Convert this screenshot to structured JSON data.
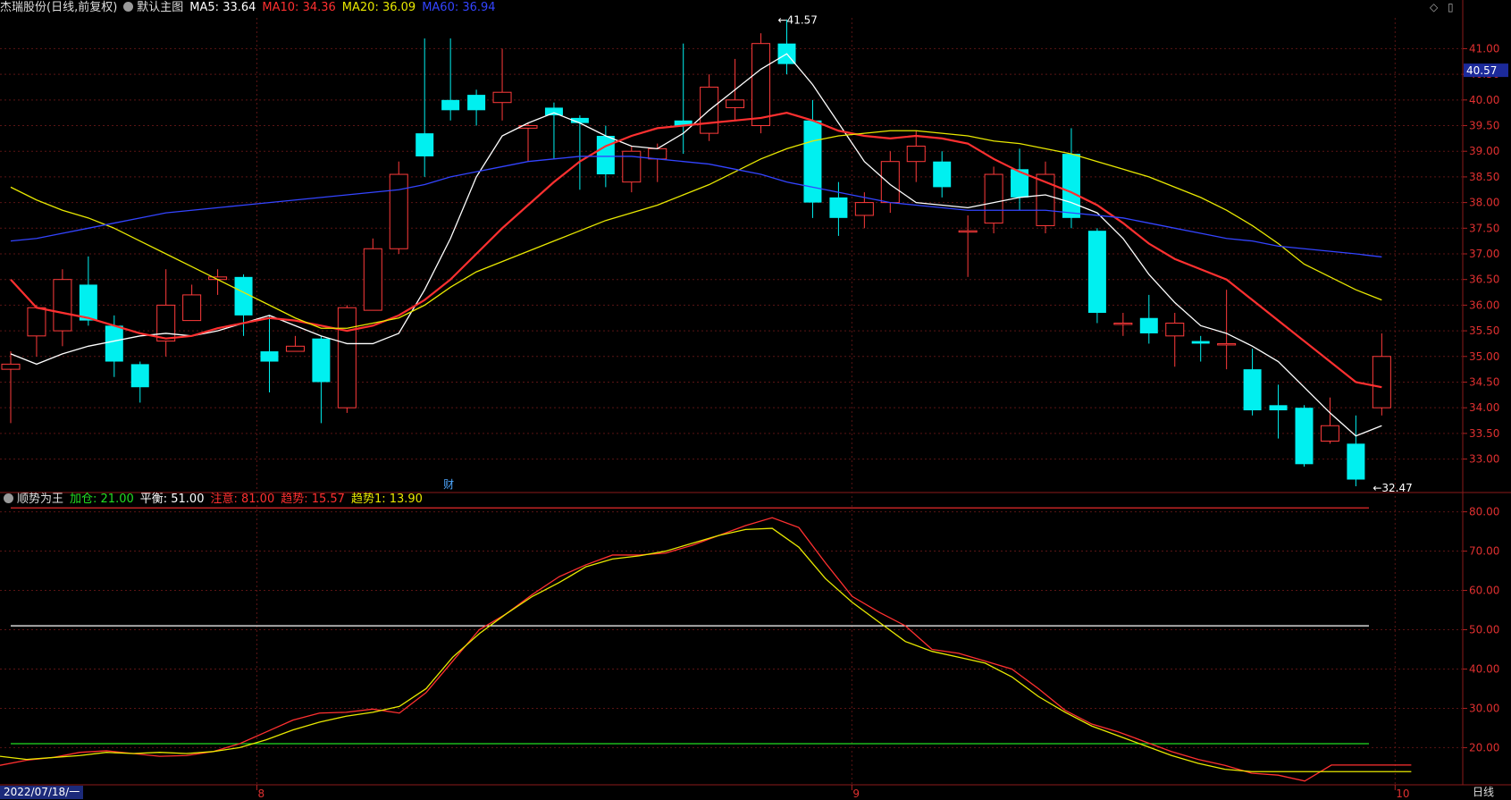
{
  "header": {
    "stock": "杰瑞股份(日线,前复权)",
    "main_chart_label": "默认主图",
    "ma": [
      {
        "label": "MA5: 33.64",
        "color": "#ffffff"
      },
      {
        "label": "MA10: 34.36",
        "color": "#ff3030"
      },
      {
        "label": "MA20: 36.09",
        "color": "#e8e800"
      },
      {
        "label": "MA60: 36.94",
        "color": "#3344ff"
      }
    ]
  },
  "indicator": {
    "name": "顺势为王",
    "items": [
      {
        "label": "加仓: 21.00",
        "color": "#22dd22"
      },
      {
        "label": "平衡: 51.00",
        "color": "#ffffff"
      },
      {
        "label": "注意: 81.00",
        "color": "#ff3030"
      },
      {
        "label": "趋势: 15.57",
        "color": "#ff3030"
      },
      {
        "label": "趋势1: 13.90",
        "color": "#e8e800"
      }
    ]
  },
  "footer": {
    "date": "2022/07/18/一",
    "period": "日线",
    "month_ticks": [
      {
        "index": 10,
        "label": "8"
      },
      {
        "index": 33,
        "label": "9"
      },
      {
        "index": 54,
        "label": "10"
      }
    ]
  },
  "chart_data": [
    {
      "type": "candlestick",
      "title": "杰瑞股份(日线,前复权)",
      "y_ticks": [
        "33.00",
        "33.50",
        "34.00",
        "34.50",
        "35.00",
        "35.50",
        "36.00",
        "36.50",
        "37.00",
        "37.50",
        "38.00",
        "38.50",
        "39.00",
        "39.50",
        "40.00",
        "40.50",
        "41.00"
      ],
      "ylim": [
        32.4,
        41.6
      ],
      "current_price": "40.57",
      "annotations": [
        {
          "label": "41.57",
          "index": 30,
          "price": 41.57
        },
        {
          "label": "32.47",
          "index": 53,
          "price": 32.47
        }
      ],
      "event_marker": {
        "label": "财",
        "index": 17
      },
      "candles": [
        {
          "o": 34.75,
          "c": 34.85,
          "h": 35.1,
          "l": 33.7
        },
        {
          "o": 35.4,
          "c": 35.95,
          "h": 36.0,
          "l": 35.0
        },
        {
          "o": 35.5,
          "c": 36.5,
          "h": 36.7,
          "l": 35.2
        },
        {
          "o": 36.4,
          "c": 35.7,
          "h": 36.95,
          "l": 35.6
        },
        {
          "o": 35.6,
          "c": 34.9,
          "h": 35.8,
          "l": 34.6
        },
        {
          "o": 34.85,
          "c": 34.4,
          "h": 34.9,
          "l": 34.1
        },
        {
          "o": 35.3,
          "c": 36.0,
          "h": 36.7,
          "l": 35.0
        },
        {
          "o": 35.7,
          "c": 36.2,
          "h": 36.4,
          "l": 35.7
        },
        {
          "o": 36.5,
          "c": 36.55,
          "h": 36.7,
          "l": 36.2
        },
        {
          "o": 36.55,
          "c": 35.8,
          "h": 36.6,
          "l": 35.4
        },
        {
          "o": 35.1,
          "c": 34.9,
          "h": 35.8,
          "l": 34.3
        },
        {
          "o": 35.1,
          "c": 35.2,
          "h": 35.4,
          "l": 35.1
        },
        {
          "o": 35.35,
          "c": 34.5,
          "h": 35.4,
          "l": 33.7
        },
        {
          "o": 34.0,
          "c": 35.95,
          "h": 36.0,
          "l": 33.9
        },
        {
          "o": 35.9,
          "c": 37.1,
          "h": 37.3,
          "l": 35.9
        },
        {
          "o": 37.1,
          "c": 38.55,
          "h": 38.8,
          "l": 37.0
        },
        {
          "o": 39.35,
          "c": 38.9,
          "h": 41.2,
          "l": 38.5
        },
        {
          "o": 40.0,
          "c": 39.8,
          "h": 41.2,
          "l": 39.6
        },
        {
          "o": 40.1,
          "c": 39.8,
          "h": 40.2,
          "l": 39.5
        },
        {
          "o": 39.95,
          "c": 40.15,
          "h": 41.0,
          "l": 39.6
        },
        {
          "o": 39.45,
          "c": 39.5,
          "h": 39.55,
          "l": 38.8
        },
        {
          "o": 39.85,
          "c": 39.7,
          "h": 39.95,
          "l": 38.85
        },
        {
          "o": 39.65,
          "c": 39.55,
          "h": 39.7,
          "l": 38.25
        },
        {
          "o": 39.3,
          "c": 38.55,
          "h": 39.5,
          "l": 38.3
        },
        {
          "o": 38.4,
          "c": 39.0,
          "h": 39.1,
          "l": 38.2
        },
        {
          "o": 38.85,
          "c": 39.05,
          "h": 39.15,
          "l": 38.4
        },
        {
          "o": 39.6,
          "c": 39.5,
          "h": 41.1,
          "l": 38.95
        },
        {
          "o": 39.35,
          "c": 40.25,
          "h": 40.5,
          "l": 39.2
        },
        {
          "o": 39.85,
          "c": 40.0,
          "h": 40.8,
          "l": 39.6
        },
        {
          "o": 39.5,
          "c": 41.1,
          "h": 41.3,
          "l": 39.35
        },
        {
          "o": 41.1,
          "c": 40.7,
          "h": 41.57,
          "l": 40.5
        },
        {
          "o": 39.6,
          "c": 38.0,
          "h": 40.0,
          "l": 37.7
        },
        {
          "o": 38.1,
          "c": 37.7,
          "h": 38.4,
          "l": 37.35
        },
        {
          "o": 37.75,
          "c": 38.0,
          "h": 38.2,
          "l": 37.5
        },
        {
          "o": 38.0,
          "c": 38.8,
          "h": 39.0,
          "l": 37.8
        },
        {
          "o": 38.8,
          "c": 39.1,
          "h": 39.4,
          "l": 38.4
        },
        {
          "o": 38.8,
          "c": 38.3,
          "h": 39.0,
          "l": 38.1
        },
        {
          "o": 37.45,
          "c": 37.45,
          "h": 37.75,
          "l": 36.55
        },
        {
          "o": 37.6,
          "c": 38.55,
          "h": 38.7,
          "l": 37.4
        },
        {
          "o": 38.65,
          "c": 38.1,
          "h": 39.05,
          "l": 37.85
        },
        {
          "o": 37.55,
          "c": 38.55,
          "h": 38.8,
          "l": 37.4
        },
        {
          "o": 38.95,
          "c": 37.7,
          "h": 39.45,
          "l": 37.5
        },
        {
          "o": 37.45,
          "c": 35.85,
          "h": 37.5,
          "l": 35.65
        },
        {
          "o": 35.65,
          "c": 35.65,
          "h": 35.85,
          "l": 35.4
        },
        {
          "o": 35.75,
          "c": 35.45,
          "h": 36.2,
          "l": 35.25
        },
        {
          "o": 35.4,
          "c": 35.65,
          "h": 35.85,
          "l": 34.8
        },
        {
          "o": 35.3,
          "c": 35.25,
          "h": 35.4,
          "l": 34.9
        },
        {
          "o": 35.25,
          "c": 35.25,
          "h": 36.3,
          "l": 34.75
        },
        {
          "o": 34.75,
          "c": 33.95,
          "h": 35.15,
          "l": 33.85
        },
        {
          "o": 34.05,
          "c": 33.95,
          "h": 34.45,
          "l": 33.4
        },
        {
          "o": 34.0,
          "c": 32.9,
          "h": 34.05,
          "l": 32.85
        },
        {
          "o": 33.35,
          "c": 33.65,
          "h": 34.2,
          "l": 33.3
        },
        {
          "o": 33.3,
          "c": 32.6,
          "h": 33.85,
          "l": 32.47
        },
        {
          "o": 34.0,
          "c": 35.0,
          "h": 35.45,
          "l": 33.85
        }
      ],
      "series": [
        {
          "name": "MA5",
          "color": "#ffffff",
          "values": [
            35.05,
            34.85,
            35.05,
            35.2,
            35.3,
            35.4,
            35.45,
            35.4,
            35.5,
            35.65,
            35.8,
            35.6,
            35.4,
            35.25,
            35.25,
            35.45,
            36.3,
            37.3,
            38.5,
            39.3,
            39.55,
            39.75,
            39.55,
            39.3,
            39.1,
            39.05,
            39.35,
            39.8,
            40.2,
            40.6,
            40.9,
            40.3,
            39.55,
            38.8,
            38.35,
            38.0,
            37.95,
            37.9,
            38.0,
            38.1,
            38.15,
            38.0,
            37.8,
            37.3,
            36.6,
            36.05,
            35.6,
            35.45,
            35.2,
            34.9,
            34.4,
            33.9,
            33.45,
            33.65
          ]
        },
        {
          "name": "MA10",
          "color": "#ff3030",
          "values": [
            36.5,
            35.95,
            35.85,
            35.75,
            35.6,
            35.45,
            35.35,
            35.4,
            35.55,
            35.65,
            35.75,
            35.7,
            35.6,
            35.5,
            35.6,
            35.8,
            36.1,
            36.5,
            37.0,
            37.5,
            37.95,
            38.4,
            38.8,
            39.1,
            39.3,
            39.45,
            39.5,
            39.55,
            39.6,
            39.65,
            39.75,
            39.6,
            39.4,
            39.3,
            39.25,
            39.3,
            39.25,
            39.15,
            38.85,
            38.6,
            38.4,
            38.2,
            37.95,
            37.6,
            37.2,
            36.9,
            36.7,
            36.5,
            36.1,
            35.7,
            35.3,
            34.9,
            34.5,
            34.4
          ]
        },
        {
          "name": "MA20",
          "color": "#e8e800",
          "values": [
            38.3,
            38.05,
            37.85,
            37.7,
            37.5,
            37.25,
            37.0,
            36.75,
            36.5,
            36.25,
            36.0,
            35.75,
            35.55,
            35.55,
            35.65,
            35.75,
            36.0,
            36.35,
            36.65,
            36.85,
            37.05,
            37.25,
            37.45,
            37.65,
            37.8,
            37.95,
            38.15,
            38.35,
            38.6,
            38.85,
            39.05,
            39.2,
            39.3,
            39.35,
            39.4,
            39.4,
            39.35,
            39.3,
            39.2,
            39.15,
            39.05,
            38.95,
            38.8,
            38.65,
            38.5,
            38.3,
            38.1,
            37.85,
            37.55,
            37.2,
            36.8,
            36.55,
            36.3,
            36.1
          ]
        },
        {
          "name": "MA60",
          "color": "#3344ff",
          "values": [
            37.25,
            37.3,
            37.4,
            37.5,
            37.6,
            37.7,
            37.8,
            37.85,
            37.9,
            37.95,
            38.0,
            38.05,
            38.1,
            38.15,
            38.2,
            38.25,
            38.35,
            38.5,
            38.6,
            38.7,
            38.8,
            38.85,
            38.9,
            38.9,
            38.9,
            38.85,
            38.8,
            38.75,
            38.65,
            38.55,
            38.4,
            38.3,
            38.2,
            38.1,
            38.0,
            37.95,
            37.9,
            37.85,
            37.85,
            37.85,
            37.85,
            37.8,
            37.75,
            37.7,
            37.6,
            37.5,
            37.4,
            37.3,
            37.25,
            37.15,
            37.1,
            37.05,
            37.0,
            36.94
          ]
        }
      ]
    },
    {
      "type": "line",
      "title": "顺势为王",
      "y_ticks": [
        "20.00",
        "30.00",
        "40.00",
        "50.00",
        "60.00",
        "70.00",
        "80.00"
      ],
      "ylim": [
        11,
        84
      ],
      "h_lines": [
        {
          "name": "加仓",
          "value": 21,
          "color": "#22dd22"
        },
        {
          "name": "平衡",
          "value": 51,
          "color": "#ffffff"
        },
        {
          "name": "注意",
          "value": 81,
          "color": "#ff3030"
        }
      ],
      "series": [
        {
          "name": "趋势",
          "color": "#ff3030",
          "values": [
            15.5,
            16.8,
            17.5,
            18.8,
            19.2,
            18.5,
            17.8,
            18.0,
            19.0,
            21.0,
            24.0,
            27.0,
            28.8,
            29.0,
            29.8,
            28.8,
            34.0,
            42.0,
            50.0,
            54.0,
            59.0,
            63.5,
            66.5,
            69.0,
            69.0,
            69.5,
            71.5,
            74.0,
            76.5,
            78.5,
            76.0,
            67.0,
            58.5,
            54.5,
            51.0,
            45.0,
            44.0,
            42.0,
            40.0,
            35.0,
            29.5,
            26.0,
            24.0,
            21.5,
            19.0,
            17.0,
            15.5,
            13.5,
            13.0,
            11.5,
            15.57,
            15.57,
            15.57,
            15.57
          ]
        },
        {
          "name": "趋势1",
          "color": "#e8e800",
          "values": [
            17.8,
            17.0,
            17.5,
            18.0,
            18.8,
            18.5,
            18.8,
            18.5,
            19.0,
            20.0,
            22.0,
            24.5,
            26.5,
            28.0,
            29.0,
            30.5,
            35.0,
            43.0,
            49.0,
            54.0,
            58.5,
            62.0,
            66.0,
            68.0,
            68.8,
            70.0,
            72.0,
            74.0,
            75.5,
            75.8,
            71.0,
            63.0,
            57.0,
            52.0,
            47.0,
            44.5,
            43.0,
            41.5,
            38.0,
            33.0,
            29.0,
            25.5,
            23.0,
            20.5,
            18.0,
            16.0,
            14.5,
            13.9,
            13.9,
            13.9,
            13.9,
            13.9,
            13.9,
            13.9
          ]
        }
      ]
    }
  ]
}
